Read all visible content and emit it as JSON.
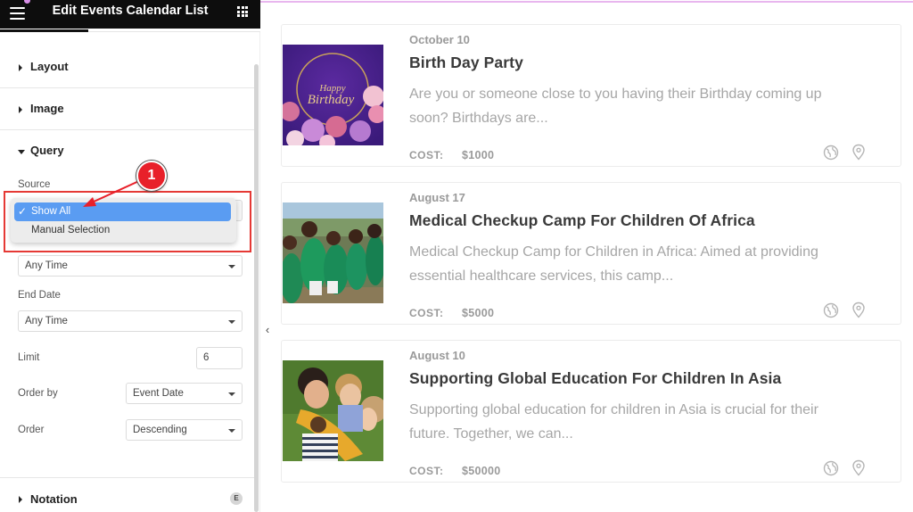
{
  "editor": {
    "title": "Edit Events Calendar List",
    "menu_icon": "hamburger-icon",
    "apps_icon": "grid-icon",
    "sections": {
      "layout": "Layout",
      "image": "Image",
      "query": "Query",
      "notation": "Notation"
    },
    "query": {
      "source_label": "Source",
      "source_options": [
        {
          "label": "Show All",
          "selected": true,
          "check": "✓"
        },
        {
          "label": "Manual Selection",
          "selected": false
        }
      ],
      "start_date_value": "Any Time",
      "end_date_label": "End Date",
      "end_date_value": "Any Time",
      "limit_label": "Limit",
      "limit_value": "6",
      "order_by_label": "Order by",
      "order_by_value": "Event Date",
      "order_label": "Order",
      "order_value": "Descending"
    },
    "annotation": {
      "callout_number": "1",
      "highlight_color": "#e53935"
    },
    "notation_badge": "E",
    "collapse_glyph": "‹"
  },
  "events": [
    {
      "date": "October 10",
      "title": "Birth Day Party",
      "excerpt": "Are you or someone close to you having their Birthday coming up soon? Birthdays are...",
      "cost_label": "COST:",
      "cost": "$1000",
      "image": "happy-birthday-balloons",
      "image_text_1": "Happy",
      "image_text_2": "Birthday"
    },
    {
      "date": "August 17",
      "title": "Medical Checkup Camp For Children Of Africa",
      "excerpt": "Medical Checkup Camp for Children in Africa: Aimed at providing essential healthcare services, this camp...",
      "cost_label": "COST:",
      "cost": "$5000",
      "image": "children-in-green-uniforms"
    },
    {
      "date": "August 10",
      "title": "Supporting Global Education For Children In Asia",
      "excerpt": "Supporting global education for children in Asia is crucial for their future. Together, we can...",
      "cost_label": "COST:",
      "cost": "$50000",
      "image": "children-hugging"
    }
  ],
  "colors": {
    "header_bg": "#0d0d0d",
    "dropdown_selected": "#5a9cf2",
    "callout_red": "#e8202a",
    "accent_pink": "#e8b6ee"
  }
}
